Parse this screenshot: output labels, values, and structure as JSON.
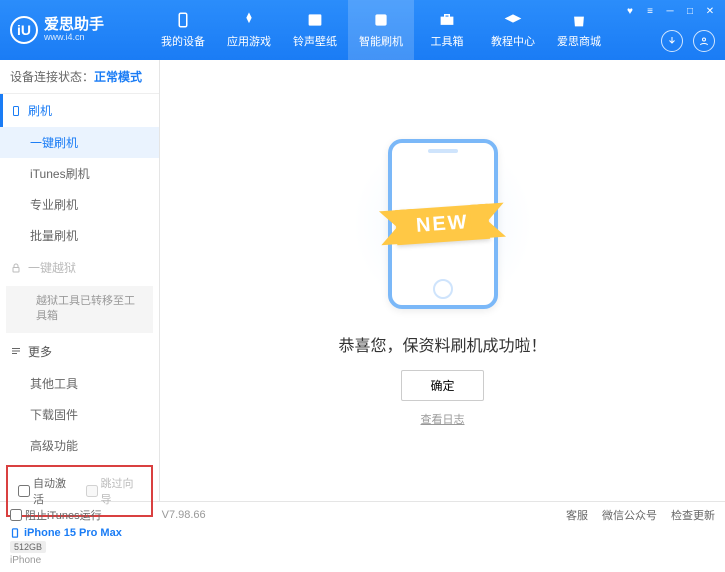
{
  "logo": {
    "badge": "iU",
    "title": "爱思助手",
    "subtitle": "www.i4.cn"
  },
  "nav": [
    {
      "label": "我的设备"
    },
    {
      "label": "应用游戏"
    },
    {
      "label": "铃声壁纸"
    },
    {
      "label": "智能刷机"
    },
    {
      "label": "工具箱"
    },
    {
      "label": "教程中心"
    },
    {
      "label": "爱思商城"
    }
  ],
  "status": {
    "prefix": "设备连接状态：",
    "mode": "正常模式"
  },
  "sidebar": {
    "flash_header": "刷机",
    "items": {
      "one_key": "一键刷机",
      "itunes": "iTunes刷机",
      "pro": "专业刷机",
      "batch": "批量刷机"
    },
    "jailbreak_header": "一键越狱",
    "jailbreak_hint": "越狱工具已转移至工具箱",
    "more_header": "更多",
    "more": {
      "other_tools": "其他工具",
      "download_fw": "下载固件",
      "advanced": "高级功能"
    },
    "cb_auto_activate": "自动激活",
    "cb_skip_guide": "跳过向导"
  },
  "device": {
    "name": "iPhone 15 Pro Max",
    "storage": "512GB",
    "type": "iPhone"
  },
  "main": {
    "ribbon": "NEW",
    "success": "恭喜您，保资料刷机成功啦！",
    "ok": "确定",
    "view_log": "查看日志"
  },
  "footer": {
    "block_itunes": "阻止iTunes运行",
    "version": "V7.98.66",
    "service": "客服",
    "wechat": "微信公众号",
    "update": "检查更新"
  }
}
